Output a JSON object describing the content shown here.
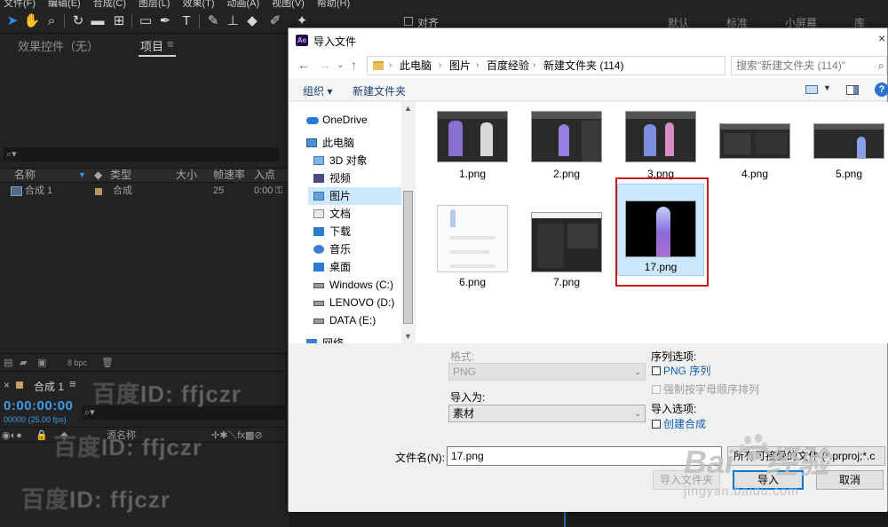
{
  "ae": {
    "menu": [
      "文件(F)",
      "编辑(E)",
      "合成(C)",
      "图层(L)",
      "效果(T)",
      "动画(A)",
      "视图(V)",
      "帮助(H)"
    ],
    "toolbar": {
      "align": "对齐",
      "workspaces": [
        "默认",
        "标准",
        "小屏幕",
        "库"
      ]
    },
    "panel": {
      "tab_effects": "效果控件（无）",
      "tab_project": "项目",
      "tab_menu": "≡",
      "search_icon": "⌕▾",
      "columns": [
        "名称",
        "类型",
        "大小",
        "帧速率",
        "入点"
      ],
      "row": {
        "name": "合成 1",
        "type": "合成",
        "fps": "25",
        "in": "0:00"
      }
    },
    "bottom_bar": {
      "bpc": "8 bpc"
    },
    "timeline": {
      "tab": "合成 1",
      "menu": "≡",
      "close": "×",
      "timecode": "0:00:00:00",
      "fps_note": "00000 (25.00 fps)",
      "source_name": "源名称"
    },
    "watermark": "百度ID: ffjczr",
    "baidu_logo": "Bai⌒经验",
    "baidu_sub": "jingyan.baidu.com"
  },
  "dialog": {
    "title": "导入文件",
    "app_badge": "Ae",
    "close": "×",
    "breadcrumbs": [
      "此电脑",
      "图片",
      "百度经验",
      "新建文件夹 (114)"
    ],
    "search_placeholder": "搜索\"新建文件夹 (114)\"",
    "commands": {
      "organize": "组织 ▾",
      "new_folder": "新建文件夹"
    },
    "nav": [
      {
        "label": "OneDrive",
        "icon": "cloud-icon"
      },
      {
        "label": "此电脑",
        "icon": "computer-icon"
      },
      {
        "label": "3D 对象",
        "icon": "cube-icon"
      },
      {
        "label": "视频",
        "icon": "video-icon"
      },
      {
        "label": "图片",
        "icon": "pictures-icon",
        "selected": true
      },
      {
        "label": "文档",
        "icon": "document-icon"
      },
      {
        "label": "下载",
        "icon": "download-icon"
      },
      {
        "label": "音乐",
        "icon": "music-icon"
      },
      {
        "label": "桌面",
        "icon": "desktop-icon"
      },
      {
        "label": "Windows (C:)",
        "icon": "drive-icon"
      },
      {
        "label": "LENOVO (D:)",
        "icon": "drive-icon"
      },
      {
        "label": "DATA (E:)",
        "icon": "drive-icon"
      },
      {
        "label": "网络",
        "icon": "network-icon"
      }
    ],
    "files": [
      {
        "name": "1.png"
      },
      {
        "name": "2.png"
      },
      {
        "name": "3.png"
      },
      {
        "name": "4.png"
      },
      {
        "name": "5.png"
      },
      {
        "name": "6.png"
      },
      {
        "name": "7.png"
      },
      {
        "name": "17.png",
        "selected": true
      }
    ],
    "options": {
      "format_label": "格式:",
      "format_value": "PNG",
      "import_as_label": "导入为:",
      "import_as_value": "素材",
      "sequence_options": "序列选项:",
      "png_sequence": "PNG 序列",
      "force_alpha": "强制按字母顺序排列",
      "import_options": "导入选项:",
      "create_comp": "创建合成"
    },
    "filename_label": "文件名(N):",
    "filename_value": "17.png",
    "filetype_value": "所有可接受的文件 (*.prproj;*.c",
    "buttons": {
      "import_folder": "导入文件夹",
      "import": "导入",
      "cancel": "取消"
    }
  }
}
